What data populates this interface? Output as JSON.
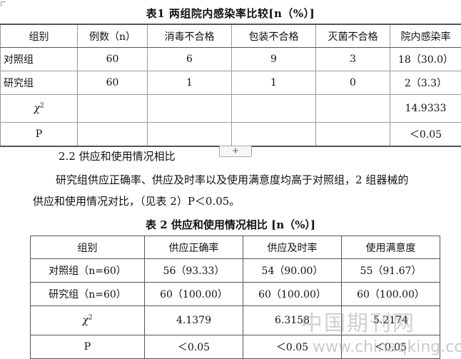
{
  "table1": {
    "title": "表1   两组院内感染率比较[n（%）]",
    "headers": [
      "组别",
      "例数（n）",
      "消毒不合格",
      "包装不合格",
      "灭菌不合格",
      "院内感染率"
    ],
    "rows": [
      [
        "对照组",
        "60",
        "6",
        "9",
        "3",
        "18（30.0）"
      ],
      [
        "研究组",
        "60",
        "1",
        "1",
        "0",
        "2（3.3）"
      ],
      [
        "χ",
        "",
        "",
        "",
        "",
        "14.9333"
      ],
      [
        "P",
        "",
        "",
        "",
        "",
        "＜0.05"
      ]
    ],
    "chi_sup": "2"
  },
  "insert_button": "+",
  "section": {
    "heading": "2.2  供应和使用情况相比",
    "para_line1": "研究组供应正确率、供应及时率以及使用满意度均高于对照组，2 组器械的",
    "para_line2": "供应和使用情况对比，（见表 2）P＜0.05。"
  },
  "table2": {
    "title": "表 2  供应和使用情况相比   [n（%）]",
    "headers": [
      "组别",
      "供应正确率",
      "供应及时率",
      "使用满意度"
    ],
    "rows": [
      [
        "对照组（n=60）",
        "56（93.33）",
        "54（90.00）",
        "55（91.67）"
      ],
      [
        "研究组（n=60）",
        "60（100.00）",
        "60（100.00）",
        "60（100.00）"
      ],
      [
        "χ",
        "4.1379",
        "6.3158",
        "5.2174"
      ],
      [
        "P",
        "＜0.05",
        "＜0.05",
        "＜0.05"
      ]
    ],
    "chi_sup": "2"
  },
  "watermark": {
    "text": "中国期刊网",
    "url": "www.chinaqking.com"
  }
}
